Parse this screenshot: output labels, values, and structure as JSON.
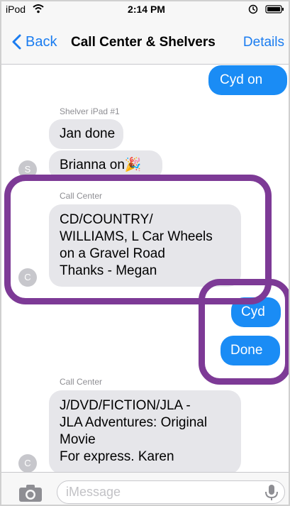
{
  "status_bar": {
    "carrier": "iPod",
    "time": "2:14 PM"
  },
  "nav": {
    "back_label": "Back",
    "title": "Call Center & Shelvers",
    "details_label": "Details"
  },
  "messages": [
    {
      "direction": "outgoing",
      "text": "Cyd on"
    },
    {
      "direction": "incoming",
      "sender": "Shelver iPad #1",
      "text": "Jan done"
    },
    {
      "direction": "incoming",
      "avatar": "S",
      "text": "Brianna on🎉"
    },
    {
      "direction": "incoming",
      "sender": "Call Center",
      "avatar": "C",
      "lines": [
        "CD/COUNTRY/",
        "WILLIAMS, L Car Wheels",
        "on a Gravel Road",
        "Thanks - Megan"
      ]
    },
    {
      "direction": "outgoing",
      "text": "Cyd"
    },
    {
      "direction": "outgoing",
      "text": "Done"
    },
    {
      "direction": "incoming",
      "sender": "Call Center",
      "avatar": "C",
      "lines": [
        "J/DVD/FICTION/JLA -",
        "JLA Adventures: Original",
        "Movie",
        "For express. Karen"
      ]
    }
  ],
  "input": {
    "placeholder": "iMessage"
  },
  "colors": {
    "accent": "#1a7cf0",
    "outgoing_bubble": "#1a8cf5",
    "incoming_bubble": "#e6e6ea",
    "highlight": "#7d3a96"
  },
  "icons": [
    "wifi-icon",
    "battery-icon",
    "chevron-left-icon",
    "camera-icon",
    "microphone-icon"
  ]
}
